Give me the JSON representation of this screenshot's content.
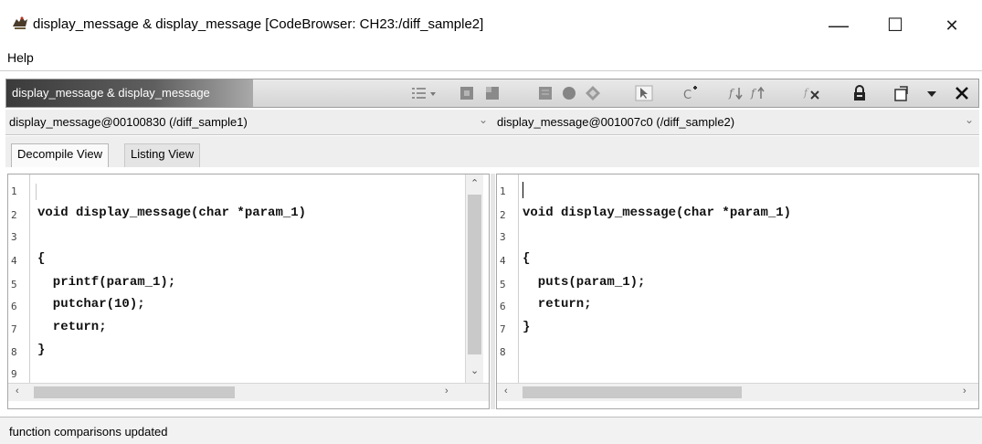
{
  "window": {
    "title": "display_message & display_message [CodeBrowser: CH23:/diff_sample2]",
    "icon": "dragon-icon",
    "minimize": "—",
    "maximize": "☐",
    "close": "✕"
  },
  "menu": {
    "items": [
      "Help"
    ]
  },
  "panel": {
    "title": "display_message & display_message",
    "toolbar_icons": [
      "list-options-icon",
      "dropdown-arrow-icon",
      "nav-back-icon",
      "nav-forward-icon",
      "block-icon",
      "circle-icon",
      "diamond-icon",
      "arrow-cursor-icon",
      "c-plus-icon",
      "function-down-icon",
      "function-up-icon",
      "function-remove-icon",
      "lock-icon",
      "snapshot-icon",
      "menu-dropdown-icon",
      "close-panel-icon"
    ]
  },
  "functions": {
    "left": "display_message@00100830 (/diff_sample1)",
    "right": "display_message@001007c0 (/diff_sample2)"
  },
  "tabs": [
    {
      "label": "Decompile View",
      "active": true
    },
    {
      "label": "Listing View",
      "active": false
    }
  ],
  "left_code": {
    "line_numbers": [
      "1",
      "2",
      "3",
      "4",
      "5",
      "6",
      "7",
      "8",
      "9"
    ],
    "lines": [
      "",
      "void display_message(char *param_1)",
      "",
      "{",
      "  printf(param_1);",
      "  putchar(10);",
      "  return;",
      "}",
      ""
    ]
  },
  "right_code": {
    "line_numbers": [
      "1",
      "2",
      "3",
      "4",
      "5",
      "6",
      "7",
      "8"
    ],
    "lines": [
      "",
      "void display_message(char *param_1)",
      "",
      "{",
      "  puts(param_1);",
      "  return;",
      "}",
      ""
    ]
  },
  "status": {
    "text": "function comparisons updated"
  }
}
